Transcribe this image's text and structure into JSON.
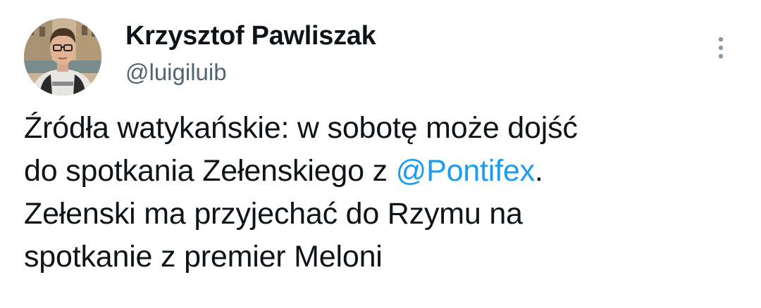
{
  "author": {
    "display_name": "Krzysztof Pawliszak",
    "handle": "@luigiluib"
  },
  "more_menu": {
    "icon": "more-vertical-icon"
  },
  "tweet": {
    "line1": "Źródła watykańskie: w sobotę może dojść",
    "line2_prefix": "do spotkania Zełenskiego z ",
    "mention": "@Pontifex",
    "line2_suffix": ".",
    "line3": "Zełenski ma przyjechać do Rzymu na",
    "line4": "spotkanie z premier Meloni"
  },
  "colors": {
    "text": "#0f1419",
    "secondary": "#536471",
    "link": "#1d9bf0",
    "background": "#ffffff"
  }
}
